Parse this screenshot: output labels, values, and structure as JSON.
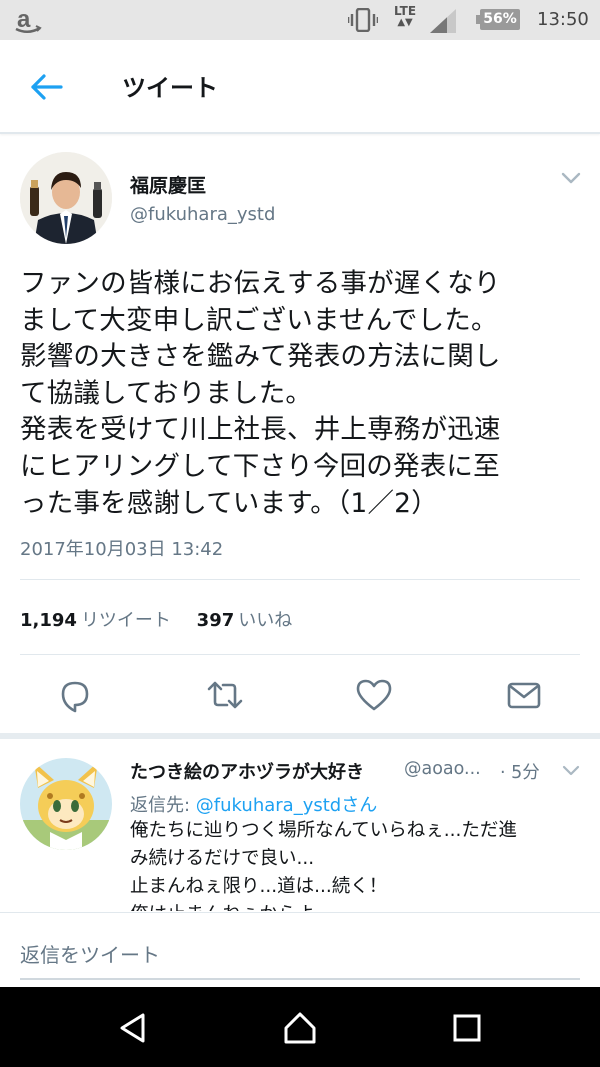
{
  "status_bar": {
    "network": "LTE",
    "battery": "56%",
    "time": "13:50"
  },
  "header": {
    "title": "ツイート"
  },
  "tweet": {
    "author_name": "福原慶匡",
    "author_handle": "@fukuhara_ystd",
    "text": "ファンの皆様にお伝えする事が遅くなり\nまして大変申し訳ございませんでした。\n影響の大きさを鑑みて発表の方法に関し\nて協議しておりました。\n発表を受けて川上社長、井上専務が迅速\nにヒアリングして下さり今回の発表に至\nった事を感謝しています。（1／2）",
    "timestamp": "2017年10月03日 13:42",
    "retweet_count": "1,194",
    "retweet_label": "リツイート",
    "like_count": "397",
    "like_label": "いいね"
  },
  "reply": {
    "author_name": "たつき絵のアホヅラが大好き",
    "author_handle": "@aoao...",
    "time": "· 5分",
    "reply_to_label": "返信先: ",
    "reply_to_mention": "@fukuhara_ystdさん",
    "text": "俺たちに辿りつく場所なんていらねぇ...ただ進\nみ続けるだけで良い...\n止まんねぇ限り...道は...続く！\n俺は止まんねぇからよ..."
  },
  "compose": {
    "placeholder": "返信をツイート"
  },
  "colors": {
    "accent": "#1da1f2",
    "secondary_text": "#657786",
    "divider": "#e1e8ed"
  },
  "icons": {
    "status": [
      "amazon-icon",
      "vibrate-icon",
      "signal-icon",
      "battery-icon"
    ],
    "actions": [
      "reply-icon",
      "retweet-icon",
      "like-icon",
      "direct-message-icon"
    ],
    "navigation": [
      "back-nav-icon",
      "home-nav-icon",
      "recents-nav-icon"
    ]
  }
}
